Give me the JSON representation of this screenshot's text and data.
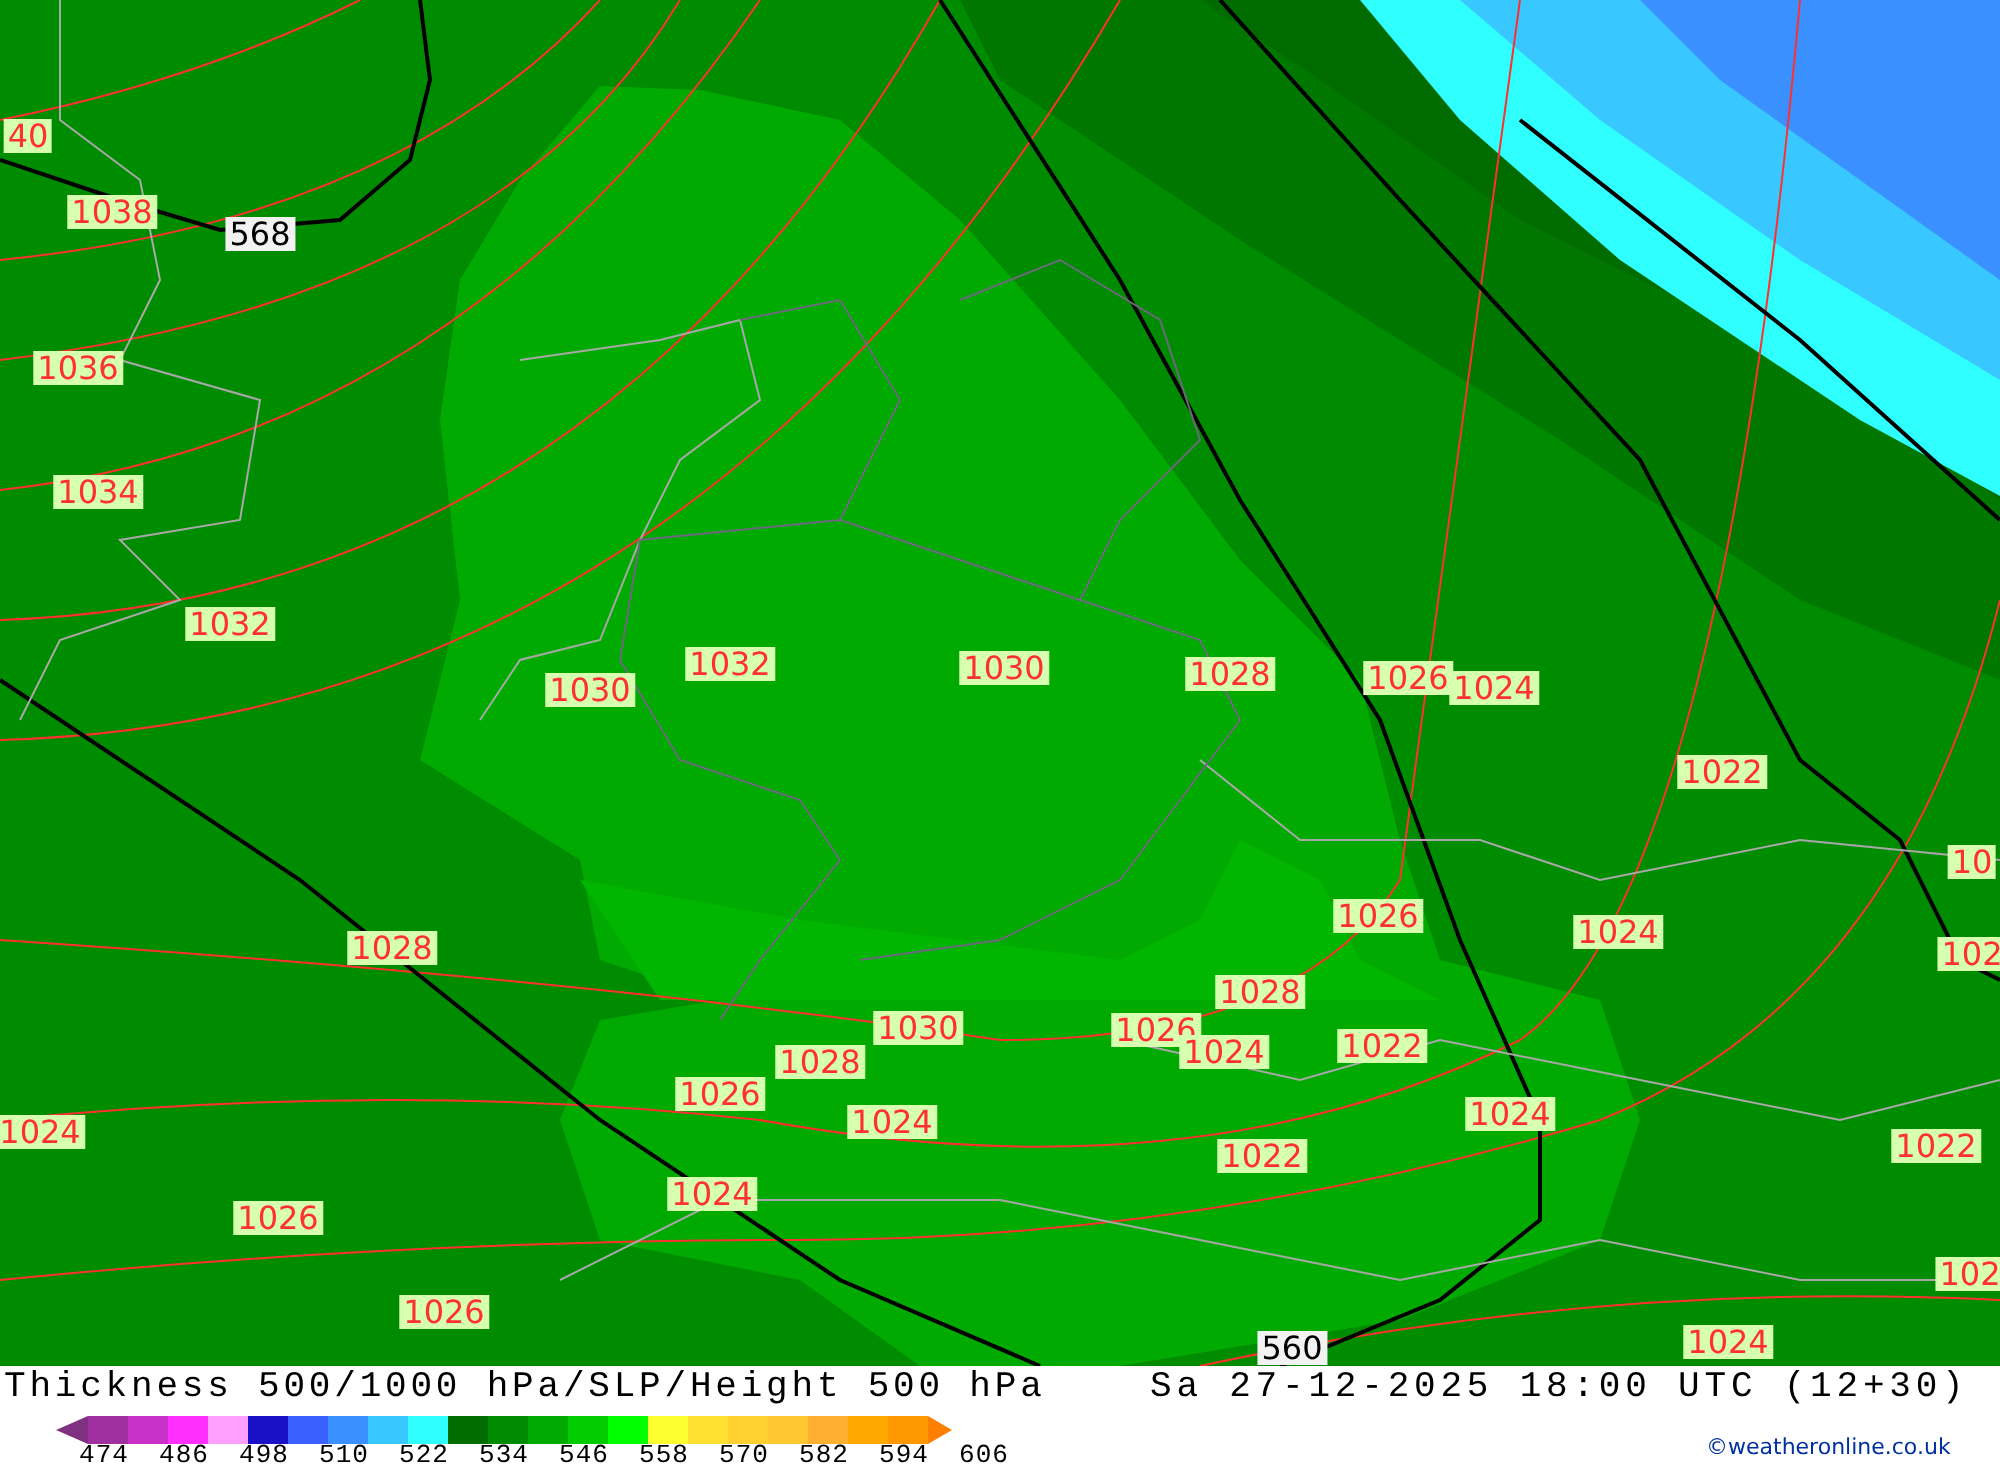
{
  "map": {
    "labels": [
      {
        "kind": "isobar",
        "text": "40"
      },
      {
        "kind": "isobar",
        "text": "1038"
      },
      {
        "kind": "height",
        "text": "568"
      },
      {
        "kind": "isobar",
        "text": "1036"
      },
      {
        "kind": "isobar",
        "text": "1034"
      },
      {
        "kind": "isobar",
        "text": "1032"
      },
      {
        "kind": "isobar",
        "text": "1030"
      },
      {
        "kind": "isobar",
        "text": "1032"
      },
      {
        "kind": "isobar",
        "text": "1030"
      },
      {
        "kind": "isobar",
        "text": "1028"
      },
      {
        "kind": "isobar",
        "text": "1026"
      },
      {
        "kind": "isobar",
        "text": "1024"
      },
      {
        "kind": "isobar",
        "text": "1022"
      },
      {
        "kind": "isobar",
        "text": "10"
      },
      {
        "kind": "isobar",
        "text": "1026"
      },
      {
        "kind": "isobar",
        "text": "1024"
      },
      {
        "kind": "isobar",
        "text": "102"
      },
      {
        "kind": "isobar",
        "text": "1028"
      },
      {
        "kind": "isobar",
        "text": "1028"
      },
      {
        "kind": "isobar",
        "text": "1030"
      },
      {
        "kind": "isobar",
        "text": "1026"
      },
      {
        "kind": "isobar",
        "text": "1024"
      },
      {
        "kind": "isobar",
        "text": "1028"
      },
      {
        "kind": "isobar",
        "text": "1022"
      },
      {
        "kind": "isobar",
        "text": "1026"
      },
      {
        "kind": "isobar",
        "text": "1024"
      },
      {
        "kind": "isobar",
        "text": "1024"
      },
      {
        "kind": "isobar",
        "text": "1022"
      },
      {
        "kind": "isobar",
        "text": "1022"
      },
      {
        "kind": "isobar",
        "text": "1024"
      },
      {
        "kind": "isobar",
        "text": "1024"
      },
      {
        "kind": "isobar",
        "text": "1026"
      },
      {
        "kind": "isobar",
        "text": "102"
      },
      {
        "kind": "isobar",
        "text": "1026"
      },
      {
        "kind": "isobar",
        "text": "1024"
      },
      {
        "kind": "height",
        "text": "560"
      }
    ]
  },
  "title": "Thickness 500/1000 hPa/SLP/Height 500 hPa",
  "valid_time": "Sa 27-12-2025 18:00 UTC (12+30)",
  "legend": {
    "bands": [
      {
        "color": "#a030a0"
      },
      {
        "color": "#c830c8"
      },
      {
        "color": "#ff30ff"
      },
      {
        "color": "#ffa0ff"
      },
      {
        "color": "#1a10c8"
      },
      {
        "color": "#3a60ff"
      },
      {
        "color": "#3a90ff"
      },
      {
        "color": "#38c8ff"
      },
      {
        "color": "#30ffff"
      },
      {
        "color": "#006c00"
      },
      {
        "color": "#008c00"
      },
      {
        "color": "#00aa00"
      },
      {
        "color": "#00cc00"
      },
      {
        "color": "#00ff00"
      },
      {
        "color": "#ffff30"
      },
      {
        "color": "#ffe030"
      },
      {
        "color": "#ffd030"
      },
      {
        "color": "#ffc830"
      },
      {
        "color": "#ffb030"
      },
      {
        "color": "#ffa800"
      },
      {
        "color": "#ff9800"
      }
    ],
    "ticks": [
      "474",
      "486",
      "498",
      "510",
      "522",
      "534",
      "546",
      "558",
      "570",
      "582",
      "594",
      "606"
    ]
  },
  "credit": "©weatheronline.co.uk"
}
